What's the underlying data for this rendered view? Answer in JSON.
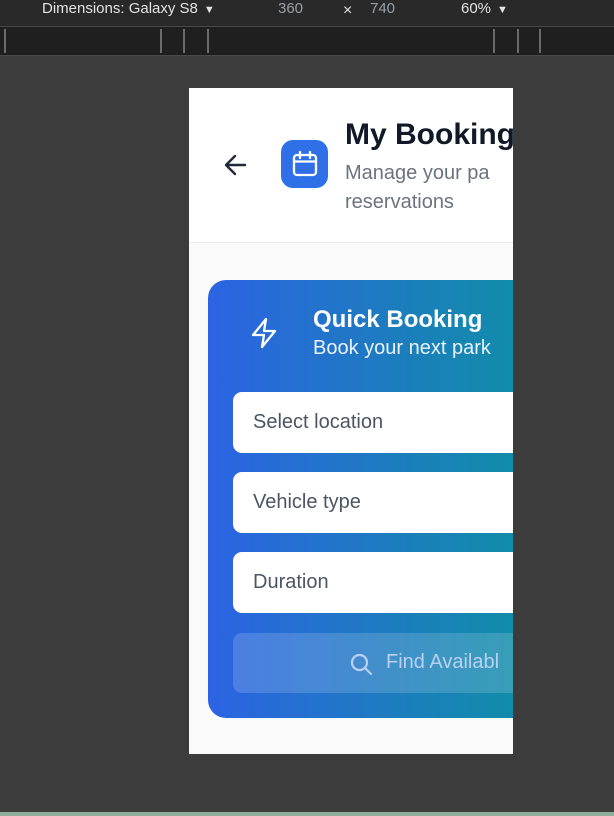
{
  "devtools": {
    "dimensions_label": "Dimensions: Galaxy S8",
    "width": "360",
    "height": "740",
    "times": "×",
    "zoom": "60%",
    "caret": "▼"
  },
  "header": {
    "title": "My Booking",
    "subtitle": "Manage your pa reservations",
    "back_icon": "arrow-left-icon",
    "calendar_icon": "calendar-icon",
    "accent_color": "#2f6fe8"
  },
  "quick_booking": {
    "title": "Quick Booking",
    "subtitle": "Book your next park",
    "icon": "lightning-bolt-icon",
    "gradient_start": "#2c63e3",
    "gradient_end": "#0f8fa6",
    "location_placeholder": "Select location",
    "vehicle_placeholder": "Vehicle type",
    "duration_placeholder": "Duration",
    "find_label": "Find Availabl",
    "find_icon": "search-icon"
  }
}
